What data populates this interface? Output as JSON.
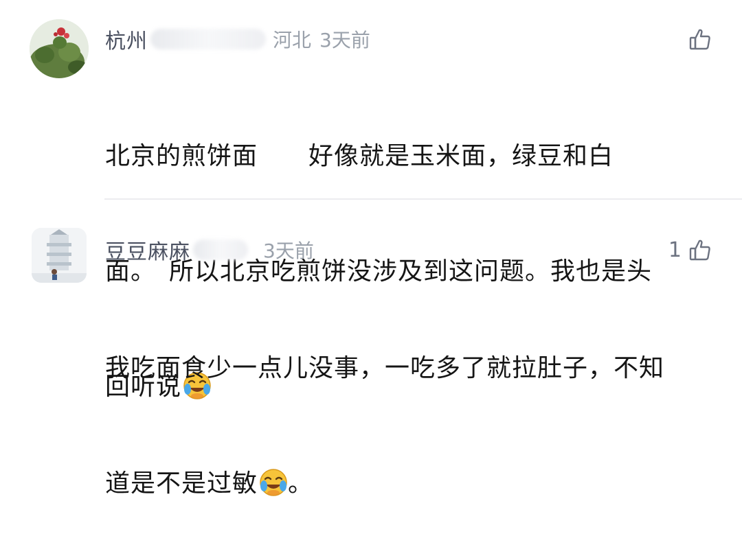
{
  "comments": [
    {
      "username": "杭州",
      "location": "河北",
      "time": "3天前",
      "like_count": "",
      "lines": [
        "北京的煎饼面　　好像就是玉米面，绿豆和白",
        "面。　所以北京吃煎饼没涉及到这问题。我也是头",
        "回听说"
      ],
      "emoji": "laughing-crying-emoji",
      "trailing": ""
    },
    {
      "username": "豆豆麻麻",
      "location": "",
      "time": "3天前",
      "like_count": "1",
      "lines": [
        "我吃面食少一点儿没事，一吃多了就拉肚子，不知",
        "道是不是过敏"
      ],
      "emoji": "laughing-crying-emoji",
      "trailing": "。"
    }
  ],
  "colors": {
    "username": "#4a5060",
    "meta": "#9aa1ab",
    "text": "#151515",
    "divider": "#ececef"
  }
}
